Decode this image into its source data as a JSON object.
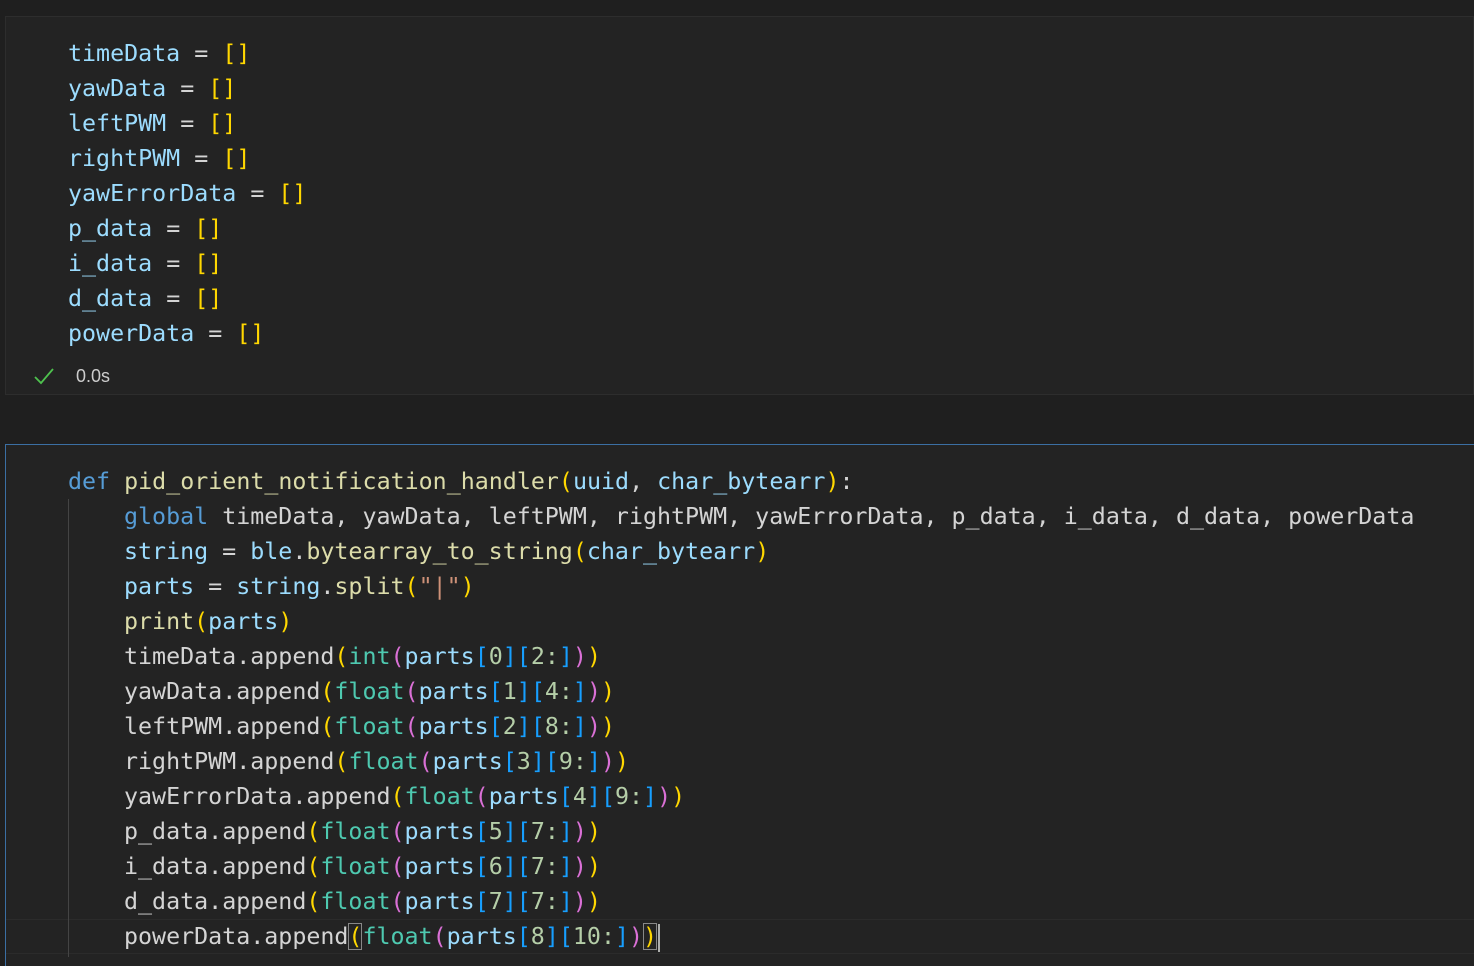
{
  "cell1": {
    "lines": [
      {
        "name": "timeData",
        "op": "=",
        "val": "[]"
      },
      {
        "name": "yawData",
        "op": "=",
        "val": "[]"
      },
      {
        "name": "leftPWM",
        "op": "=",
        "val": "[]"
      },
      {
        "name": "rightPWM",
        "op": "=",
        "val": "[]"
      },
      {
        "name": "yawErrorData",
        "op": "=",
        "val": "[]"
      },
      {
        "name": "p_data",
        "op": "=",
        "val": "[]"
      },
      {
        "name": "i_data",
        "op": "=",
        "val": "[]"
      },
      {
        "name": "d_data",
        "op": "=",
        "val": "[]"
      },
      {
        "name": "powerData",
        "op": "=",
        "val": "[]"
      }
    ],
    "status": {
      "icon": "check-icon",
      "time": "0.0s",
      "color": "#4ec24e"
    }
  },
  "cell2": {
    "def_kw": "def",
    "func_name": "pid_orient_notification_handler",
    "param1": "uuid",
    "param2": "char_bytearr",
    "global_kw": "global",
    "global_vars": "timeData, yawData, leftPWM, rightPWM, yawErrorData, p_data, i_data, d_data, powerData",
    "line_string": {
      "var": "string",
      "obj": "ble",
      "method": "bytearray_to_string",
      "arg": "char_bytearr"
    },
    "line_parts": {
      "var": "parts",
      "obj": "string",
      "method": "split",
      "arg": "\"|\""
    },
    "line_print": {
      "fn": "print",
      "arg": "parts"
    },
    "appends": [
      {
        "target": "timeData",
        "conv": "int",
        "idx": "0",
        "slice": "2:"
      },
      {
        "target": "yawData",
        "conv": "float",
        "idx": "1",
        "slice": "4:"
      },
      {
        "target": "leftPWM",
        "conv": "float",
        "idx": "2",
        "slice": "8:"
      },
      {
        "target": "rightPWM",
        "conv": "float",
        "idx": "3",
        "slice": "9:"
      },
      {
        "target": "yawErrorData",
        "conv": "float",
        "idx": "4",
        "slice": "9:"
      },
      {
        "target": "p_data",
        "conv": "float",
        "idx": "5",
        "slice": "7:"
      },
      {
        "target": "i_data",
        "conv": "float",
        "idx": "6",
        "slice": "7:"
      },
      {
        "target": "d_data",
        "conv": "float",
        "idx": "7",
        "slice": "7:"
      },
      {
        "target": "powerData",
        "conv": "float",
        "idx": "8",
        "slice": "10:"
      }
    ],
    "append_method": "append",
    "parts_name": "parts"
  },
  "colors": {
    "background": "#1f1f1f",
    "cell": "#232323",
    "focus_border": "#3b6fa3",
    "variable": "#9cdcfe",
    "keyword": "#569cd6",
    "function": "#dcdcaa",
    "builtin_type": "#4ec9b0",
    "number": "#b5cea8",
    "string": "#ce9178",
    "bracket_1": "#ffd700",
    "bracket_2": "#da70d6",
    "bracket_3": "#179fff"
  }
}
